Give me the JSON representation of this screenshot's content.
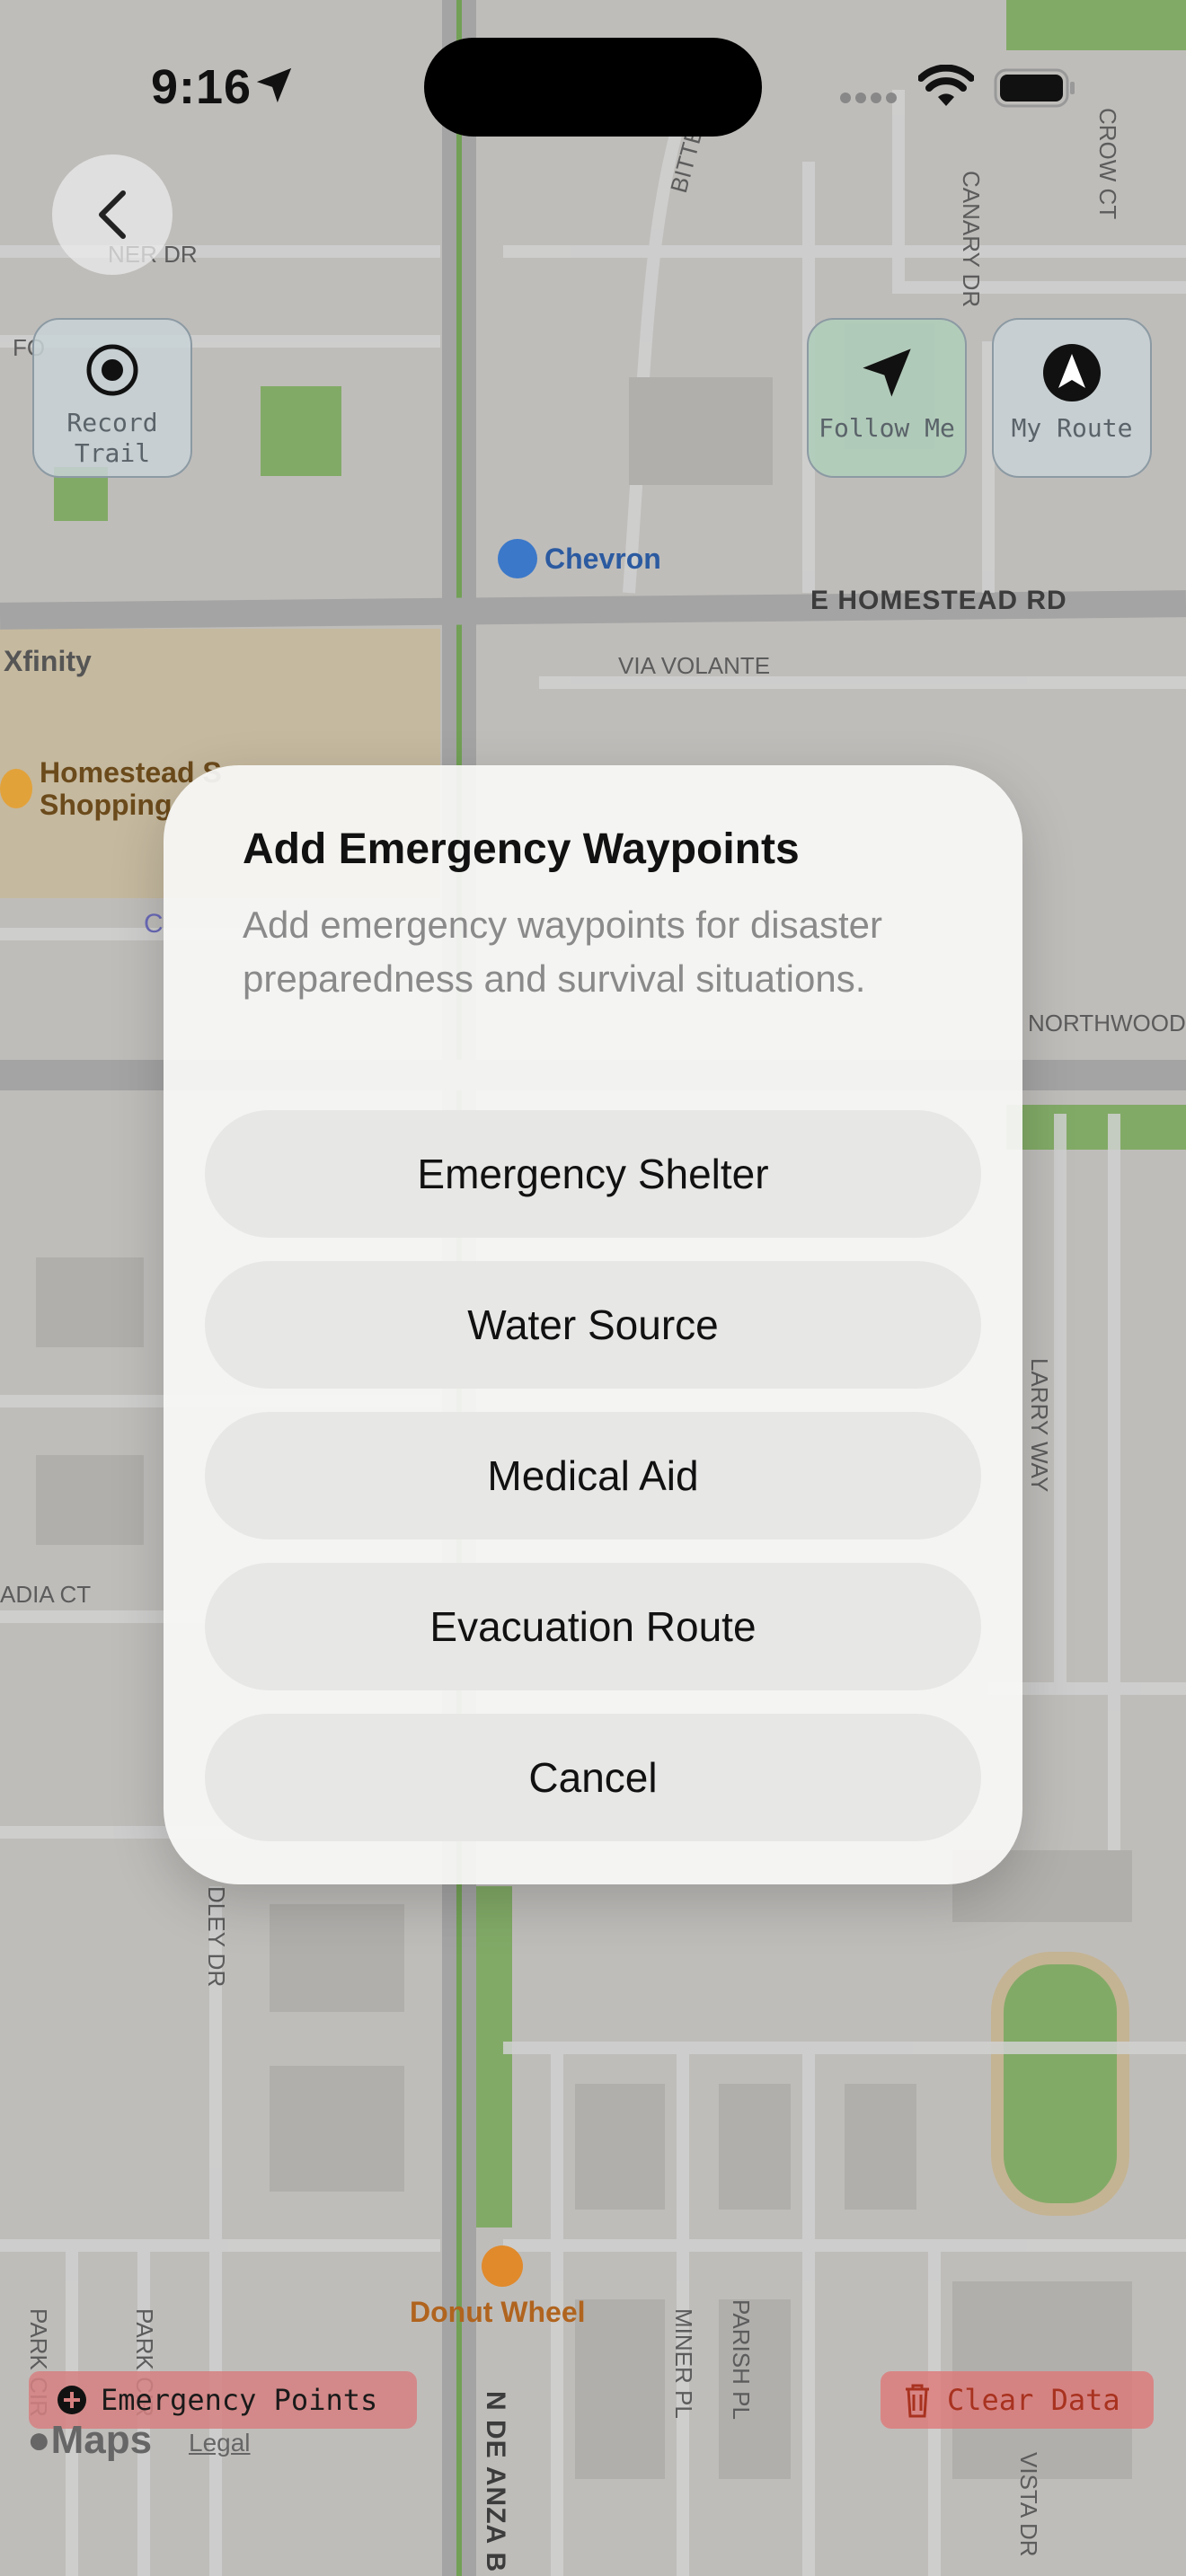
{
  "status_bar": {
    "time": "9:16"
  },
  "toolbar": {
    "record_trail": {
      "line1": "Record",
      "line2": "Trail"
    },
    "follow_me": "Follow Me",
    "my_route": "My Route"
  },
  "map_labels": {
    "chevron": "Chevron",
    "xfinity": "Xfinity",
    "homestead_1": "Homestead S",
    "homestead_2": "Shopping",
    "e_homestead": "E HOMESTEAD RD",
    "via_volante": "VIA VOLANTE",
    "northwood": "NORTHWOOD",
    "larry_way": "LARRY WAY",
    "adia_ct": "ADIA CT",
    "dley_dr": "DLEY DR",
    "donut_wheel": "Donut Wheel",
    "miner_pl": "MINER PL",
    "parish_pl": "PARISH PL",
    "vista_dr": "VISTA DR",
    "n_de_anza": "N DE ANZA B",
    "park_cir_1": "PARK CIR",
    "park_cir_2": "PARK CIR",
    "canary_dr": "CANARY DR",
    "crow_ct": "CROW CT",
    "bittern": "BITTERN",
    "ner_dr": "NER DR",
    "fo": "FO",
    "c": "C"
  },
  "dialog": {
    "title": "Add Emergency Waypoints",
    "message": "Add emergency waypoints for disaster preparedness and survival situations.",
    "buttons": [
      "Emergency Shelter",
      "Water Source",
      "Medical Aid",
      "Evacuation Route",
      "Cancel"
    ]
  },
  "bottom": {
    "emergency_points": "Emergency Points",
    "clear_data": "Clear Data",
    "maps": "Maps",
    "legal": "Legal"
  },
  "colors": {
    "accent_green": "#b0cdba",
    "clear_red": "#a8321f",
    "map_green": "#8cc46a"
  }
}
